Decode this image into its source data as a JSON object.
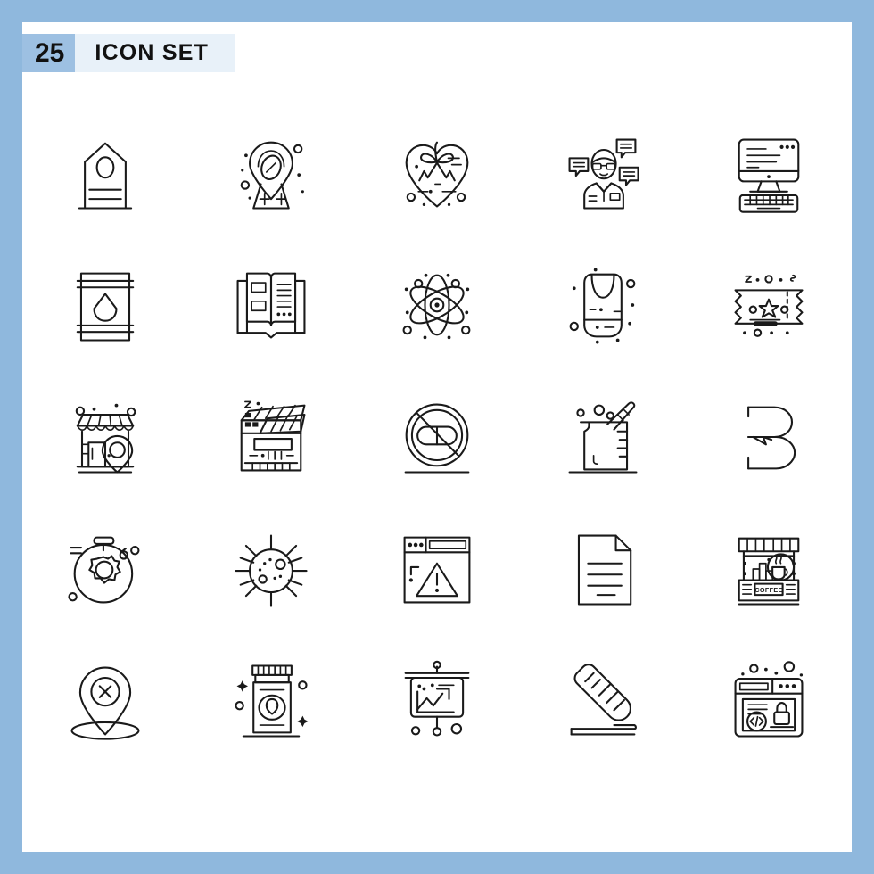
{
  "header": {
    "count": "25",
    "title": "ICON SET"
  },
  "colors": {
    "page_border": "#8fb8dd",
    "card_background": "#ffffff",
    "count_badge": "#9dc0e2",
    "title_band": "#e8f1f9",
    "icon_stroke": "#1a1a1a"
  },
  "grid": {
    "columns": 5,
    "rows": 5,
    "total": 25
  },
  "icons": [
    {
      "index": 1,
      "name": "tag-label-icon",
      "label": "Tag"
    },
    {
      "index": 2,
      "name": "coffee-location-pin-icon",
      "label": "Location"
    },
    {
      "index": 3,
      "name": "heart-gift-ribbon-icon",
      "label": "Gift Heart"
    },
    {
      "index": 4,
      "name": "support-agent-chat-icon",
      "label": "Support"
    },
    {
      "index": 5,
      "name": "desktop-computer-icon",
      "label": "Computer"
    },
    {
      "index": 6,
      "name": "oil-barrel-drop-icon",
      "label": "Barrel"
    },
    {
      "index": 7,
      "name": "open-book-icon",
      "label": "Book"
    },
    {
      "index": 8,
      "name": "atom-molecule-icon",
      "label": "Atom"
    },
    {
      "index": 9,
      "name": "baby-bib-icon",
      "label": "Bib"
    },
    {
      "index": 10,
      "name": "star-ticket-icon",
      "label": "Ticket"
    },
    {
      "index": 11,
      "name": "shop-location-icon",
      "label": "Shop"
    },
    {
      "index": 12,
      "name": "clapperboard-icon",
      "label": "Clapperboard"
    },
    {
      "index": 13,
      "name": "no-drugs-prohibition-icon",
      "label": "No Drugs"
    },
    {
      "index": 14,
      "name": "beaker-measuring-cup-icon",
      "label": "Beaker"
    },
    {
      "index": 15,
      "name": "letter-b-logo-icon",
      "label": "Letter B"
    },
    {
      "index": 16,
      "name": "stopwatch-gear-icon",
      "label": "Optimization"
    },
    {
      "index": 17,
      "name": "virus-germ-icon",
      "label": "Virus"
    },
    {
      "index": 18,
      "name": "browser-warning-icon",
      "label": "Error"
    },
    {
      "index": 19,
      "name": "document-file-icon",
      "label": "Document"
    },
    {
      "index": 20,
      "name": "coffee-shop-stall-icon",
      "label": "Coffee Shop"
    },
    {
      "index": 21,
      "name": "location-pin-cancel-icon",
      "label": "No Location"
    },
    {
      "index": 22,
      "name": "medicine-bottle-icon",
      "label": "Medicine"
    },
    {
      "index": 23,
      "name": "presentation-chart-icon",
      "label": "Presentation"
    },
    {
      "index": 24,
      "name": "eyedropper-pipette-icon",
      "label": "Eyedropper"
    },
    {
      "index": 25,
      "name": "browser-security-code-icon",
      "label": "Secure Code"
    }
  ],
  "icon_text": {
    "coffee_sign": "COFFEE"
  }
}
